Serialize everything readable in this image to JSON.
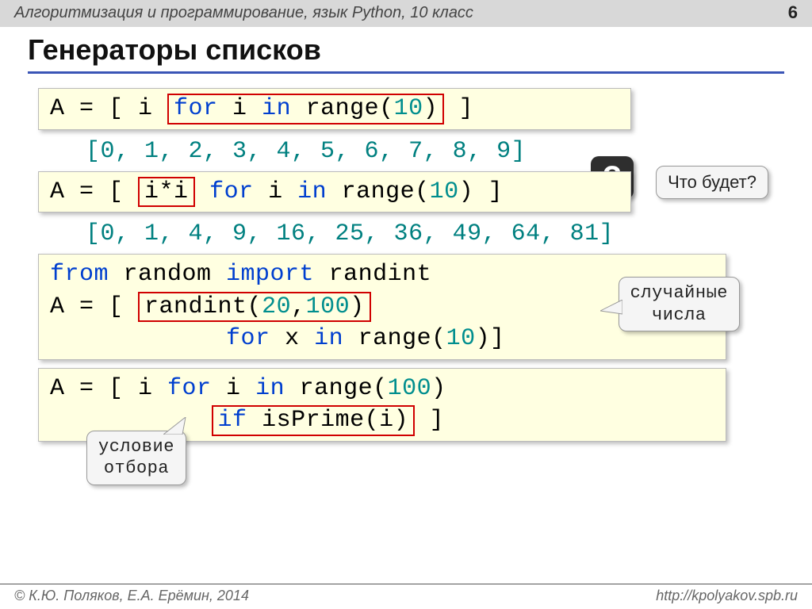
{
  "header": {
    "course": "Алгоритмизация и программирование, язык Python, 10 класс",
    "page": "6"
  },
  "title": "Генераторы списков",
  "box1": {
    "pre": "A = [ i ",
    "hl_for": "for",
    "hl_mid": " i ",
    "hl_in": "in",
    "hl_sp": " range(",
    "hl_ten": "10",
    "hl_end": ")",
    "post": " ]"
  },
  "result1": "[0, 1, 2, 3, 4, 5, 6, 7, 8, 9]",
  "q_label": "?",
  "q_text": "Что будет?",
  "box2": {
    "pre": "A = [ ",
    "hl": "i*i",
    "for_kw": "for",
    "mid": " i ",
    "in_kw": "in",
    "rng": " range(",
    "ten": "10",
    "close": ") ]"
  },
  "result2": "[0, 1, 4, 9, 16, 25, 36, 49, 64, 81]",
  "box3": {
    "l1_from": "from",
    "l1_mid": " random ",
    "l1_import": "import",
    "l1_end": " randint",
    "l2_pre": "A = [ ",
    "l2_fn": "randint(",
    "l2_a": "20",
    "l2_comma": ",",
    "l2_b": "100",
    "l2_close": ")",
    "l3_indent": "            ",
    "l3_for": "for",
    "l3_mid": " x ",
    "l3_in": "in",
    "l3_rng": " range(",
    "l3_ten": "10",
    "l3_close": ")]"
  },
  "callout_rand": "случайные\nчисла",
  "box4": {
    "l1_pre": "A = [ i ",
    "l1_for": "for",
    "l1_mid": " i ",
    "l1_in": "in",
    "l1_rng": " range(",
    "l1_n": "100",
    "l1_close": ")",
    "l2_indent": "           ",
    "l2_if": "if",
    "l2_call": " isPrime(i)",
    "l2_end": " ]"
  },
  "callout_filter": "условие\nотбора",
  "footer": {
    "left": "© К.Ю. Поляков, Е.А. Ерёмин, 2014",
    "right": "http://kpolyakov.spb.ru"
  }
}
